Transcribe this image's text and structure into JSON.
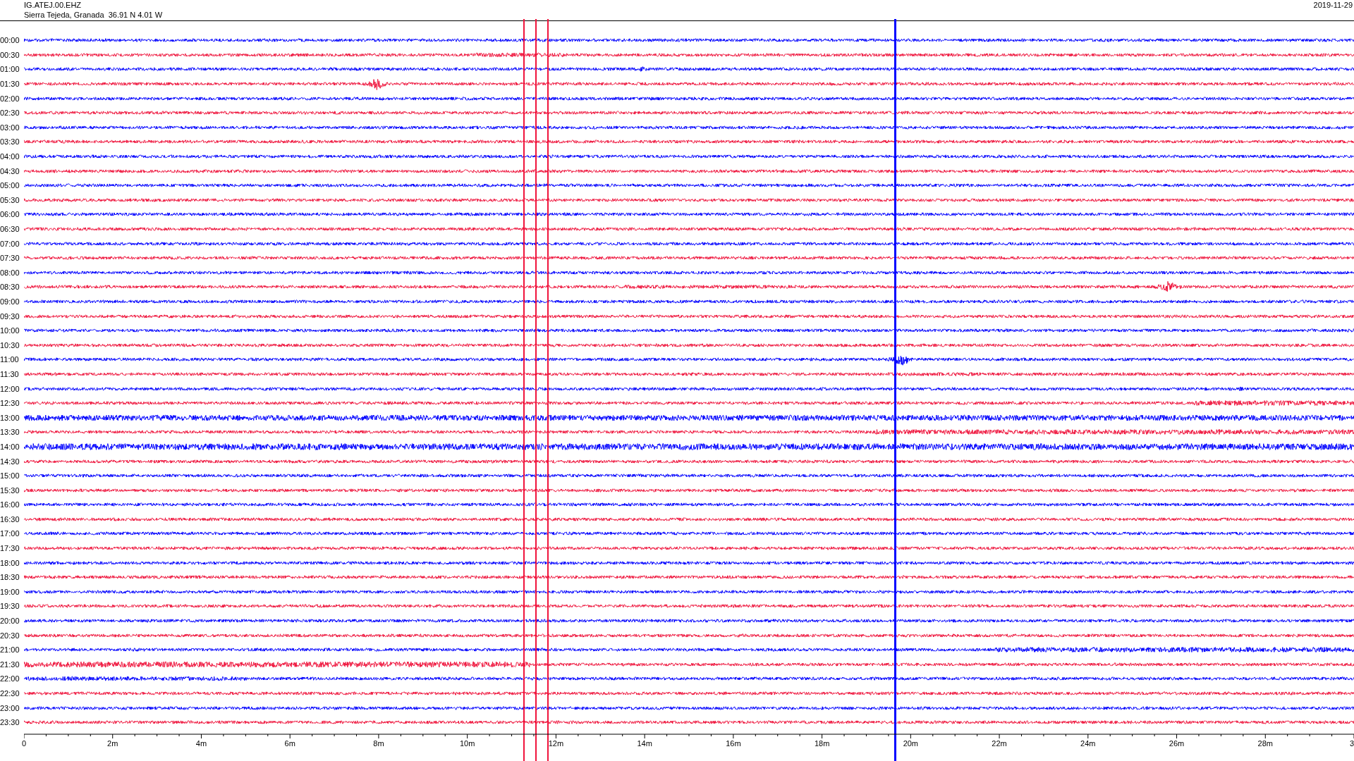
{
  "header": {
    "station": "IG.ATEJ.00.EHZ",
    "location": "Sierra Tejeda, Granada  36.91 N 4.01 W",
    "date": "2019-11-29"
  },
  "traces": [
    {
      "time": "00:00",
      "color": "#0000ff"
    },
    {
      "time": "00:30",
      "color": "#f0143c"
    },
    {
      "time": "01:00",
      "color": "#0000ff"
    },
    {
      "time": "01:30",
      "color": "#f0143c"
    },
    {
      "time": "02:00",
      "color": "#0000ff"
    },
    {
      "time": "02:30",
      "color": "#f0143c"
    },
    {
      "time": "03:00",
      "color": "#0000ff"
    },
    {
      "time": "03:30",
      "color": "#f0143c"
    },
    {
      "time": "04:00",
      "color": "#0000ff"
    },
    {
      "time": "04:30",
      "color": "#f0143c"
    },
    {
      "time": "05:00",
      "color": "#0000ff"
    },
    {
      "time": "05:30",
      "color": "#f0143c"
    },
    {
      "time": "06:00",
      "color": "#0000ff"
    },
    {
      "time": "06:30",
      "color": "#f0143c"
    },
    {
      "time": "07:00",
      "color": "#0000ff"
    },
    {
      "time": "07:30",
      "color": "#f0143c"
    },
    {
      "time": "08:00",
      "color": "#0000ff"
    },
    {
      "time": "08:30",
      "color": "#f0143c"
    },
    {
      "time": "09:00",
      "color": "#0000ff"
    },
    {
      "time": "09:30",
      "color": "#f0143c"
    },
    {
      "time": "10:00",
      "color": "#0000ff"
    },
    {
      "time": "10:30",
      "color": "#f0143c"
    },
    {
      "time": "11:00",
      "color": "#0000ff"
    },
    {
      "time": "11:30",
      "color": "#f0143c"
    },
    {
      "time": "12:00",
      "color": "#0000ff"
    },
    {
      "time": "12:30",
      "color": "#f0143c"
    },
    {
      "time": "13:00",
      "color": "#0000ff"
    },
    {
      "time": "13:30",
      "color": "#f0143c"
    },
    {
      "time": "14:00",
      "color": "#0000ff"
    },
    {
      "time": "14:30",
      "color": "#f0143c"
    },
    {
      "time": "15:00",
      "color": "#0000ff"
    },
    {
      "time": "15:30",
      "color": "#f0143c"
    },
    {
      "time": "16:00",
      "color": "#0000ff"
    },
    {
      "time": "16:30",
      "color": "#f0143c"
    },
    {
      "time": "17:00",
      "color": "#0000ff"
    },
    {
      "time": "17:30",
      "color": "#f0143c"
    },
    {
      "time": "18:00",
      "color": "#0000ff"
    },
    {
      "time": "18:30",
      "color": "#f0143c"
    },
    {
      "time": "19:00",
      "color": "#0000ff"
    },
    {
      "time": "19:30",
      "color": "#f0143c"
    },
    {
      "time": "20:00",
      "color": "#0000ff"
    },
    {
      "time": "20:30",
      "color": "#f0143c"
    },
    {
      "time": "21:00",
      "color": "#0000ff"
    },
    {
      "time": "21:30",
      "color": "#f0143c"
    },
    {
      "time": "22:00",
      "color": "#0000ff"
    },
    {
      "time": "22:30",
      "color": "#f0143c"
    },
    {
      "time": "23:00",
      "color": "#0000ff"
    },
    {
      "time": "23:30",
      "color": "#f0143c"
    }
  ],
  "markers": [
    {
      "color": "#f0143c"
    },
    {
      "color": "#f0143c"
    },
    {
      "color": "#f0143c"
    },
    {
      "color": "#0000ff"
    }
  ],
  "x_axis": {
    "labels": [
      "0",
      "2m",
      "4m",
      "6m",
      "8m",
      "10m",
      "12m",
      "14m",
      "16m",
      "18m",
      "20m",
      "22m",
      "24m",
      "26m",
      "28m",
      "3"
    ]
  }
}
